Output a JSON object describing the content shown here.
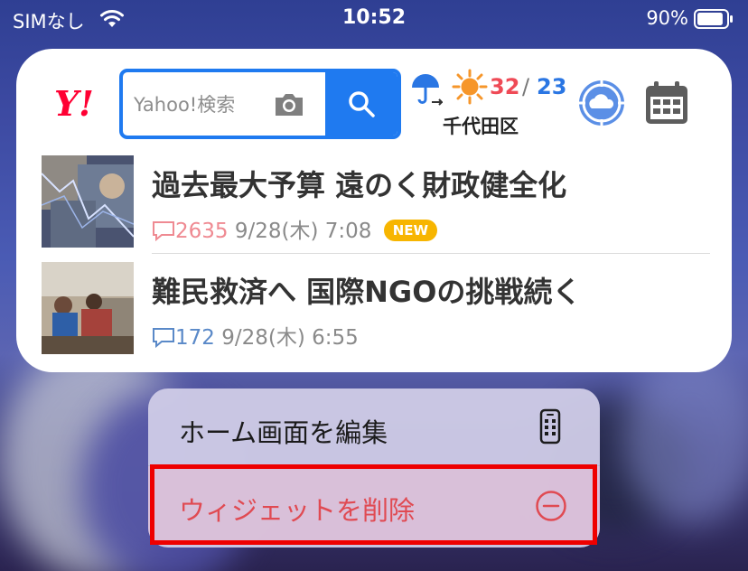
{
  "status_bar": {
    "carrier": "SIMなし",
    "time": "10:52",
    "battery": "90%",
    "battery_level": 0.9
  },
  "widget": {
    "search": {
      "placeholder": "Yahoo!検索"
    },
    "weather": {
      "high": "32",
      "separator": "/",
      "low": "23",
      "location": "千代田区",
      "icons": [
        "umbrella-icon",
        "sun-icon"
      ]
    },
    "news": [
      {
        "title": "過去最大予算 遠のく財政健全化",
        "comments": "2635",
        "date": "9/28(木) 7:08",
        "badge": "NEW"
      },
      {
        "title": "難民救済へ 国際NGOの挑戦続く",
        "comments": "172",
        "date": "9/28(木) 6:55"
      }
    ]
  },
  "context_menu": {
    "items": [
      {
        "label": "ホーム画面を編集",
        "icon": "phone-icon"
      },
      {
        "label": "ウィジェットを削除",
        "icon": "minus-circle-icon"
      }
    ]
  },
  "colors": {
    "brand_red": "#ff0033",
    "search_blue": "#1f7af0",
    "delete_red": "#e04a52",
    "highlight": "#ee0000"
  }
}
